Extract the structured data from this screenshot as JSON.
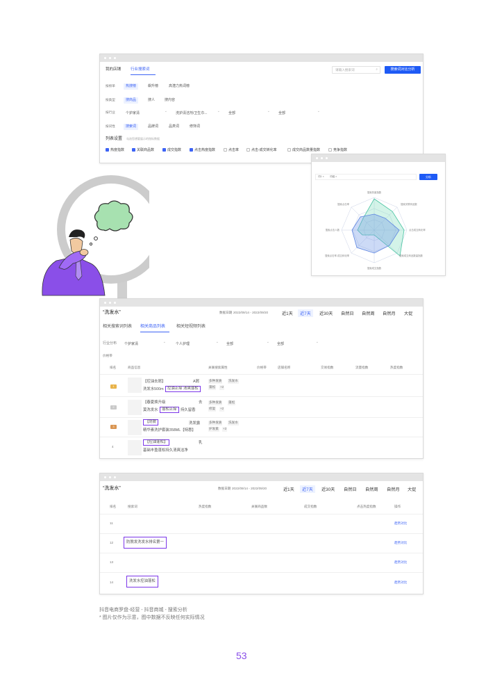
{
  "win1": {
    "nav": [
      "我的店铺",
      "行业搜索词"
    ],
    "search_placeholder": "请输入搜索词",
    "analyze_button": "搜索词对比分析",
    "filters": [
      {
        "label": "按榜单",
        "options": [
          "热搜榜",
          "飙升榜",
          "高潜力热词榜"
        ]
      },
      {
        "label": "按类型",
        "options": [
          "搜商品",
          "搜人",
          "搜内容"
        ]
      },
      {
        "label": "按行业",
        "selects": [
          "个护家清",
          "洗护清洁剂/卫生巾...",
          "全部",
          "全部"
        ]
      },
      {
        "label": "按词性",
        "options": [
          "搜索词",
          "品牌词",
          "品类词",
          "修饰词"
        ]
      }
    ],
    "list_settings": {
      "title": "列表设置",
      "hint": "勾选您想要展示的指标数据"
    },
    "checkboxes": [
      {
        "label": "热度指数",
        "checked": true
      },
      {
        "label": "关联商品数",
        "checked": true
      },
      {
        "label": "成交指数",
        "checked": true
      },
      {
        "label": "点击热度指数",
        "checked": true
      },
      {
        "label": "点击率",
        "checked": false
      },
      {
        "label": "点击-成交转化率",
        "checked": false
      },
      {
        "label": "成交商品数量指数",
        "checked": false
      },
      {
        "label": "竞争指数",
        "checked": false
      }
    ]
  },
  "win2": {
    "tags": [
      "词1 ×",
      "词组 ×"
    ],
    "analyze_button": "分析",
    "radar_labels": [
      "搜索热度指数",
      "搜索关联商品数",
      "点击成交转化率",
      "搜索成交商品数量指数",
      "搜索成交指数",
      "搜索点击率-成交转化率",
      "搜索点击人数",
      "搜索点击率"
    ]
  },
  "win3": {
    "title": "“洗发水”",
    "date_label": "数据日期",
    "date_range": "2022/09/14 - 2022/09/20",
    "period_tabs": [
      "近1天",
      "近7天",
      "近30天",
      "自然日",
      "自然周",
      "自然月",
      "大促"
    ],
    "subtabs": [
      "相关搜索词列表",
      "相关商品列表",
      "相关短视频列表"
    ],
    "industry_label": "行业分布",
    "selects": [
      "个护家清",
      "个人护理",
      "全部",
      "全部"
    ],
    "price_label": "价格带",
    "columns": [
      "排名",
      "商品信息",
      "关联搜索属性",
      "价格带",
      "店铺名称",
      "交易指数",
      "流量指数",
      "热度指数"
    ],
    "rows": [
      {
        "rank": "1",
        "title_a": "【控油去屑】",
        "title_b": "洗发水500m",
        "highlight": "控油止痒 清爽蓬松",
        "tail": "A屑",
        "tags": [
          "多种发质",
          "洗发水",
          "蓬松",
          "+2"
        ]
      },
      {
        "rank": "2",
        "title_a": "【春夏焕升级",
        "title_b": "莫洗发水",
        "highlight": "蓬松止痒",
        "tail": "持久留香",
        "end": "去",
        "tags": [
          "多种发质",
          "蓬松",
          "修复",
          "+2"
        ]
      },
      {
        "rank": "3",
        "title_a": "",
        "highlight_a": "【防脱",
        "title_b": "精华素洗护套装358ML【特惠】",
        "end": "洗发露",
        "tags": [
          "多种发质",
          "洗发水",
          "护发素",
          "+3"
        ]
      },
      {
        "rank": "4",
        "highlight_a": "【控油蓬松】",
        "title_b": "基础丰盈蓬松持久清爽洁净",
        "end": "乳"
      }
    ]
  },
  "win4": {
    "title": "“洗发水”",
    "date_label": "数据日期",
    "date_range": "2022/09/14 - 2022/09/20",
    "period_tabs": [
      "近1天",
      "近7天",
      "近30天",
      "自然日",
      "自然周",
      "自然月",
      "大促"
    ],
    "columns": [
      "排名",
      "搜索词",
      "热度指数",
      "关联商品数",
      "成交指数",
      "点击热度指数",
      "操作"
    ],
    "rows": [
      {
        "rank": "11",
        "keyword": "",
        "action": "趋势对比"
      },
      {
        "rank": "12",
        "keyword": "防脱发洗发水排名第一",
        "action": "趋势对比"
      },
      {
        "rank": "13",
        "keyword": "",
        "action": "趋势对比"
      },
      {
        "rank": "14",
        "keyword": "洗发水控油蓬松",
        "action": "趋势对比"
      }
    ]
  },
  "caption": {
    "line1": "抖音电商罗盘-经营 - 抖音商城 - 搜索分析",
    "line2": "* 图片仅作为示意，图中数据不反映任何实际情况"
  },
  "page_number": "53",
  "colors": {
    "accent": "#3d63f5",
    "highlight": "#7b35e8",
    "purple_shirt": "#8a4fe8"
  }
}
